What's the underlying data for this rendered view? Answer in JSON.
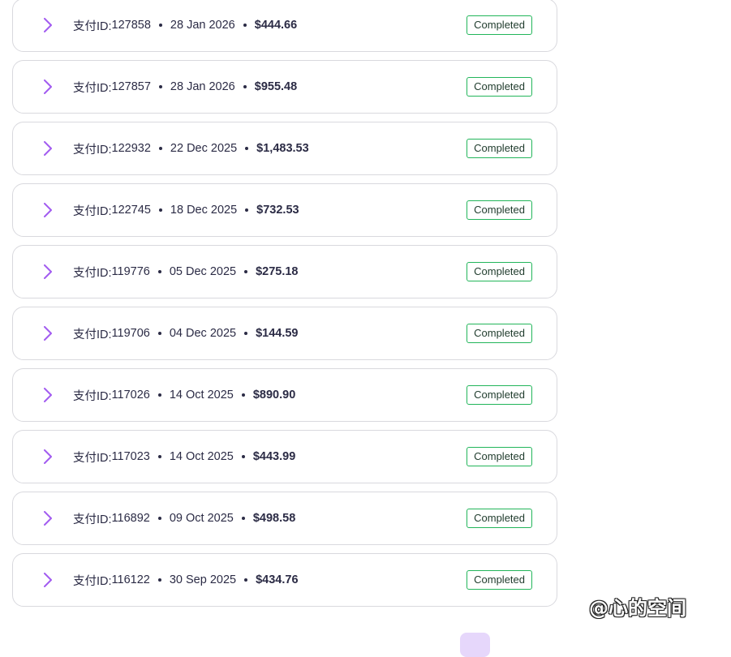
{
  "id_label": "支付ID:",
  "payments": [
    {
      "id": "127858",
      "date": "28 Jan 2026",
      "amount": "$444.66",
      "status": "Completed"
    },
    {
      "id": "127857",
      "date": "28 Jan 2026",
      "amount": "$955.48",
      "status": "Completed"
    },
    {
      "id": "122932",
      "date": "22 Dec 2025",
      "amount": "$1,483.53",
      "status": "Completed"
    },
    {
      "id": "122745",
      "date": "18 Dec 2025",
      "amount": "$732.53",
      "status": "Completed"
    },
    {
      "id": "119776",
      "date": "05 Dec 2025",
      "amount": "$275.18",
      "status": "Completed"
    },
    {
      "id": "119706",
      "date": "04 Dec 2025",
      "amount": "$144.59",
      "status": "Completed"
    },
    {
      "id": "117026",
      "date": "14 Oct 2025",
      "amount": "$890.90",
      "status": "Completed"
    },
    {
      "id": "117023",
      "date": "14 Oct 2025",
      "amount": "$443.99",
      "status": "Completed"
    },
    {
      "id": "116892",
      "date": "09 Oct 2025",
      "amount": "$498.58",
      "status": "Completed"
    },
    {
      "id": "116122",
      "date": "30 Sep 2025",
      "amount": "$434.76",
      "status": "Completed"
    }
  ],
  "icons": {
    "row_expand": "chevron-right-icon"
  },
  "colors": {
    "chevron": "#a25cf0",
    "status_border": "#22b55a",
    "pagination_active": "#e6d7fb"
  },
  "watermark": "@心的空间"
}
